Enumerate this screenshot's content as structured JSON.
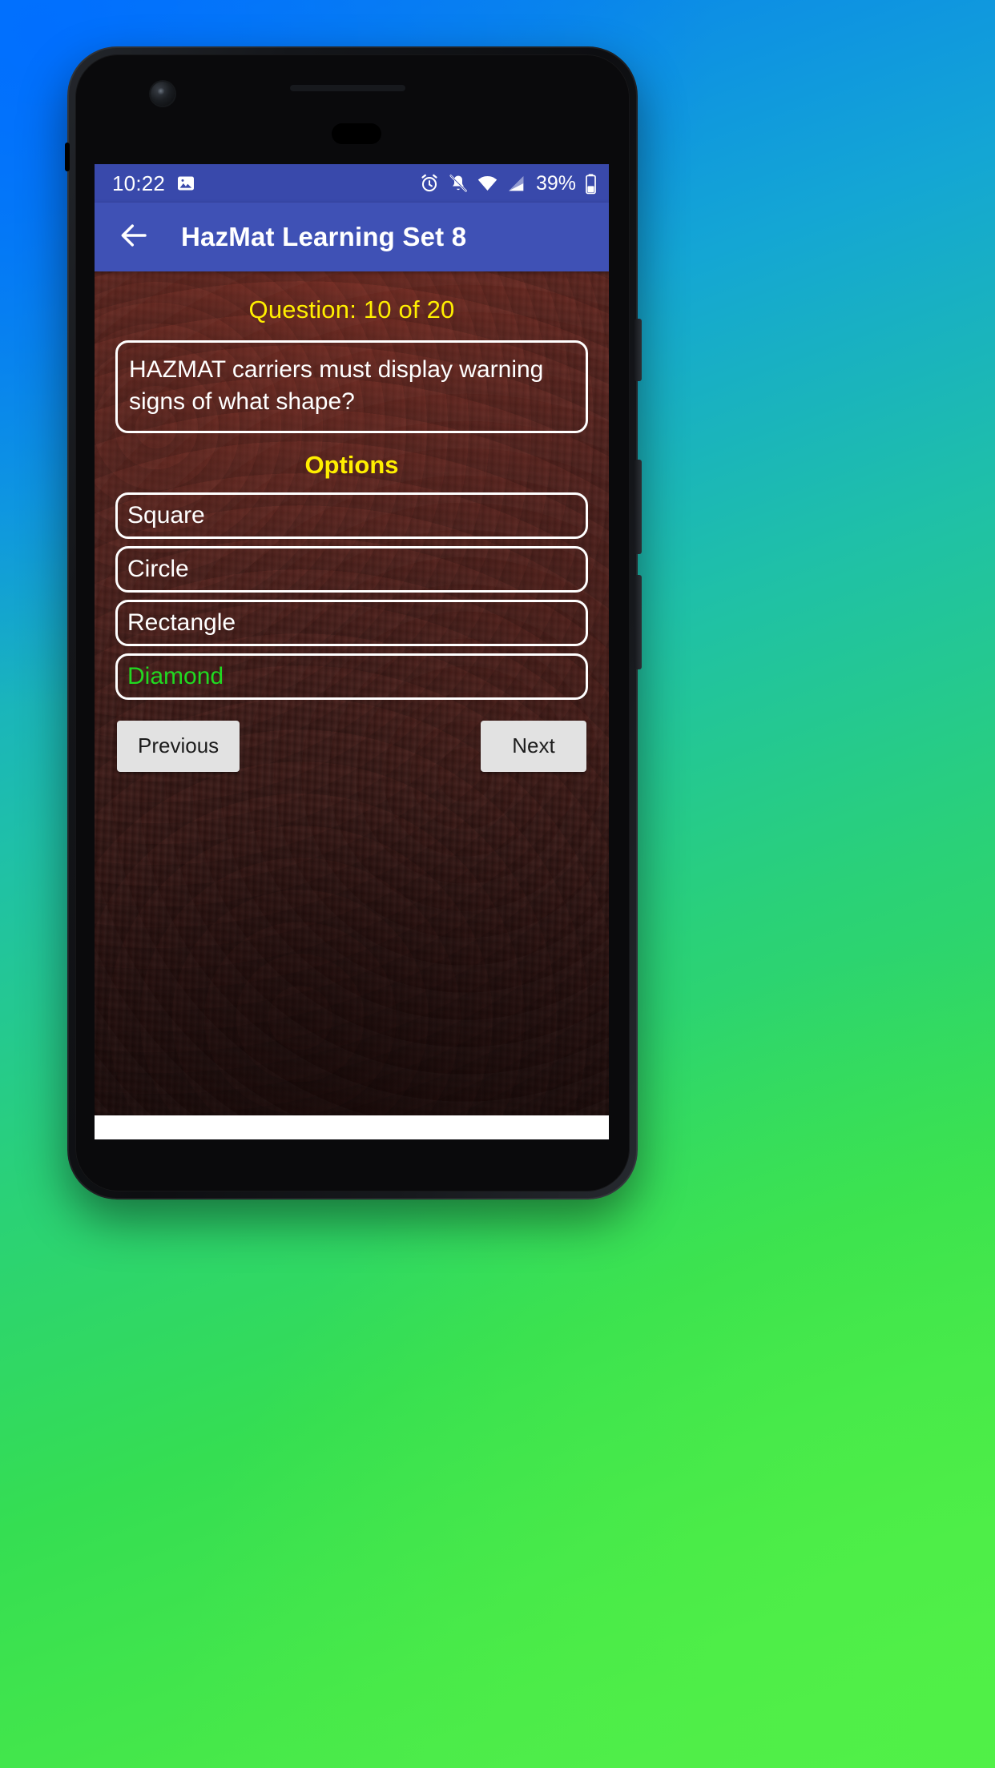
{
  "device": {
    "frame_color": "#14161a",
    "screen_bg": "#000000"
  },
  "status_bar": {
    "time": "10:22",
    "battery_percent": "39%",
    "background_color": "#3949ab",
    "icons": [
      "image-icon",
      "alarm-icon",
      "notifications-off-icon",
      "wifi-icon",
      "cell-signal-icon",
      "battery-icon"
    ]
  },
  "app_bar": {
    "title": "HazMat Learning Set 8",
    "back_icon": "arrow-back-icon",
    "background_color": "#3f51b5"
  },
  "quiz": {
    "counter_label": "Question: 10 of 20",
    "counter_color": "#ffef00",
    "question_text": "HAZMAT carriers must display warning signs of what shape?",
    "options_header": "Options",
    "options": [
      {
        "label": "Square",
        "correct": false
      },
      {
        "label": "Circle",
        "correct": false
      },
      {
        "label": "Rectangle",
        "correct": false
      },
      {
        "label": "Diamond",
        "correct": true
      }
    ],
    "correct_color": "#21d921",
    "option_text_color": "#ffffff",
    "background_color": "#4a1f1b"
  },
  "nav": {
    "previous_label": "Previous",
    "next_label": "Next",
    "button_color": "#e2e2e2"
  }
}
